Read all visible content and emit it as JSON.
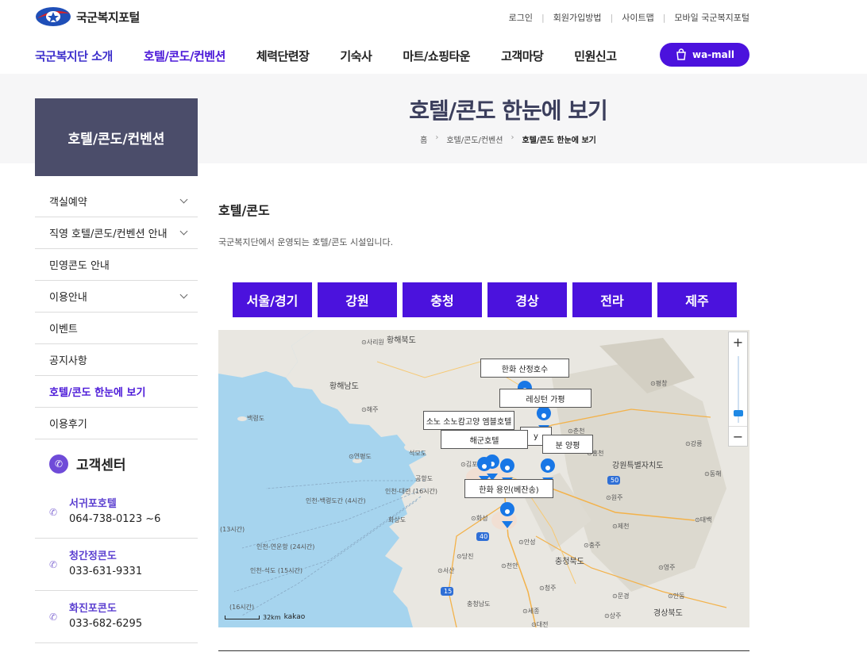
{
  "header": {
    "logo_text": "국군복지포털",
    "util_links": [
      "로그인",
      "회원가입방법",
      "사이트맵",
      "모바일 국군복지포털"
    ],
    "gnb": [
      "국군복지단 소개",
      "호텔/콘도/컨벤션",
      "체력단련장",
      "기숙사",
      "마트/쇼핑타운",
      "고객마당",
      "민원신고"
    ],
    "wamall_label": "wa-mall"
  },
  "banner": {
    "lnb_title": "호텔/콘도/컨벤션",
    "page_title": "호텔/콘도 한눈에 보기",
    "breadcrumb": [
      "홈",
      "호텔/콘도/컨벤션",
      "호텔/콘도 한눈에 보기"
    ]
  },
  "side_menu": [
    "객실예약",
    "직영 호텔/콘도/컨벤션 안내",
    "민영콘도 안내",
    "이용안내",
    "이벤트",
    "공지사항",
    "호텔/콘도 한눈에 보기",
    "이용후기"
  ],
  "customer_center": {
    "title": "고객센터",
    "items": [
      {
        "name": "서귀포호텔",
        "phone": "064-738-0123 ~6"
      },
      {
        "name": "청간정콘도",
        "phone": "033-631-9331"
      },
      {
        "name": "화진포콘도",
        "phone": "033-682-6295"
      }
    ]
  },
  "content": {
    "section_title": "호텔/콘도",
    "description": "국군복지단에서 운영되는 호텔/콘도 시설입니다.",
    "region_tabs": [
      "서울/경기",
      "강원",
      "충청",
      "경상",
      "전라",
      "제주"
    ]
  },
  "map": {
    "zoom_in": "+",
    "zoom_out": "−",
    "scale_text": "32km",
    "provider": "kakao",
    "labels": {
      "hotel_1": "한화 산정호수",
      "hotel_2": "레싱턴 가평",
      "hotel_3": "소노 소노캄고양 엠블호텔",
      "hotel_4": "y",
      "hotel_5": "해군호텔",
      "hotel_6": "분 양평",
      "hotel_7": "한화 용인(베잔송)"
    },
    "place_names": {
      "north_hwanghae": "황해북도",
      "south_hwanghae": "황해남도",
      "gangwon_full": "강원특별자치도",
      "chungbuk": "충청북도",
      "chungnam": "충청남도",
      "gyeongbuk": "경상북도",
      "sariwon": "⊙사리원",
      "haeju": "⊙해주",
      "baengnyeong": "백령도",
      "yeonpyeong": "⊙연평도",
      "ganghwa": "석모도",
      "gimpo": "⊙김포",
      "gongdo": "공항도",
      "incheon_route": "인천-대련 (16시간)",
      "baekryeong_route": "인천-백령도간 (4시간)",
      "dangjin": "⊙당진",
      "seosan": "⊙서산",
      "hwaseong": "⊙화성",
      "anseong": "⊙안성",
      "cheonan": "⊙천안",
      "cheongju": "⊙청주",
      "sejong": "⊙세종",
      "daejeon": "⊙대전",
      "chuncheon": "⊙춘천",
      "hongcheon": "⊙홍천",
      "wonju": "⊙원주",
      "jecheon": "⊙제천",
      "chungju": "⊙충주",
      "yeongju": "⊙영주",
      "mungyeong": "⊙문경",
      "andong": "⊙안동",
      "sangju": "⊙상주",
      "gangneung": "⊙강릉",
      "donghae": "⊙동해",
      "taebaek": "⊙태백",
      "pyeongchang": "⊙평창",
      "route_13": "(13시간)",
      "route_24": "인천-연운항 (24시간)",
      "route_15": "인천-석도 (15시간)",
      "route_16": "(16시간)",
      "hwasun_route": "화상도",
      "route_40": "40",
      "route_15_road": "15",
      "route_50": "50"
    }
  }
}
